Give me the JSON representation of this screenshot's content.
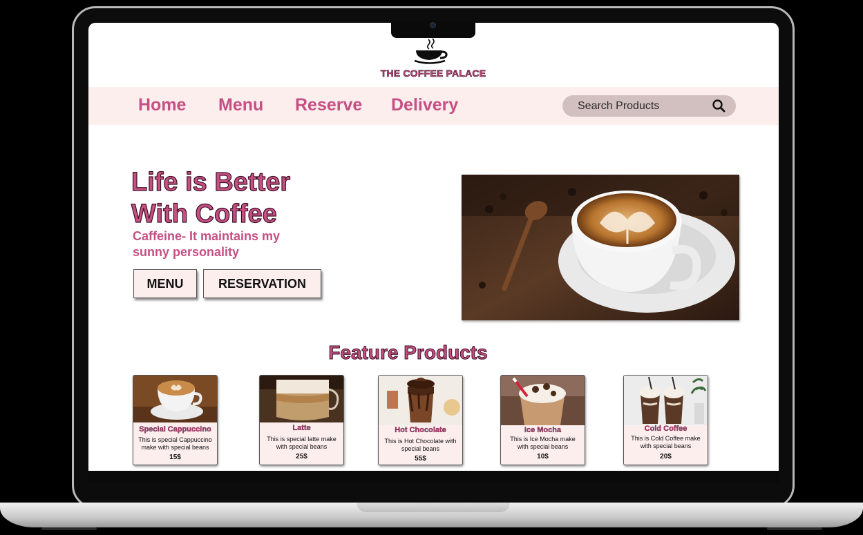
{
  "brand": {
    "name": "THE COFFEE  PALACE"
  },
  "nav": {
    "items": [
      {
        "label": "Home"
      },
      {
        "label": "Menu"
      },
      {
        "label": "Reserve"
      },
      {
        "label": "Delivery"
      }
    ],
    "search": {
      "placeholder": "Search Products"
    }
  },
  "hero": {
    "title_line1": "Life is Better",
    "title_line2": "With Coffee",
    "subtitle": "Caffeine- It maintains my sunny personality",
    "menu_button": "MENU",
    "reservation_button": "RESERVATION"
  },
  "featured": {
    "title": "Feature Products",
    "products": [
      {
        "name": "Special Cappuccino",
        "description": "This is special Cappuccino make with special beans",
        "price": "15$"
      },
      {
        "name": "Latte",
        "description": "This is special latte make with special beans",
        "price": "25$"
      },
      {
        "name": "Hot Chocolate",
        "description": "This is Hot Chocolate with special beans",
        "price": "55$"
      },
      {
        "name": "Ice Mocha",
        "description": "This is Ice Mocha make with special beans",
        "price": "10$"
      },
      {
        "name": "Cold Coffee",
        "description": "This is Cold Coffee make with special beans",
        "price": "20$"
      }
    ]
  },
  "colors": {
    "accent": "#c64f84",
    "nav_bg": "#fdeeee",
    "search_bg": "#d2bfbf"
  }
}
